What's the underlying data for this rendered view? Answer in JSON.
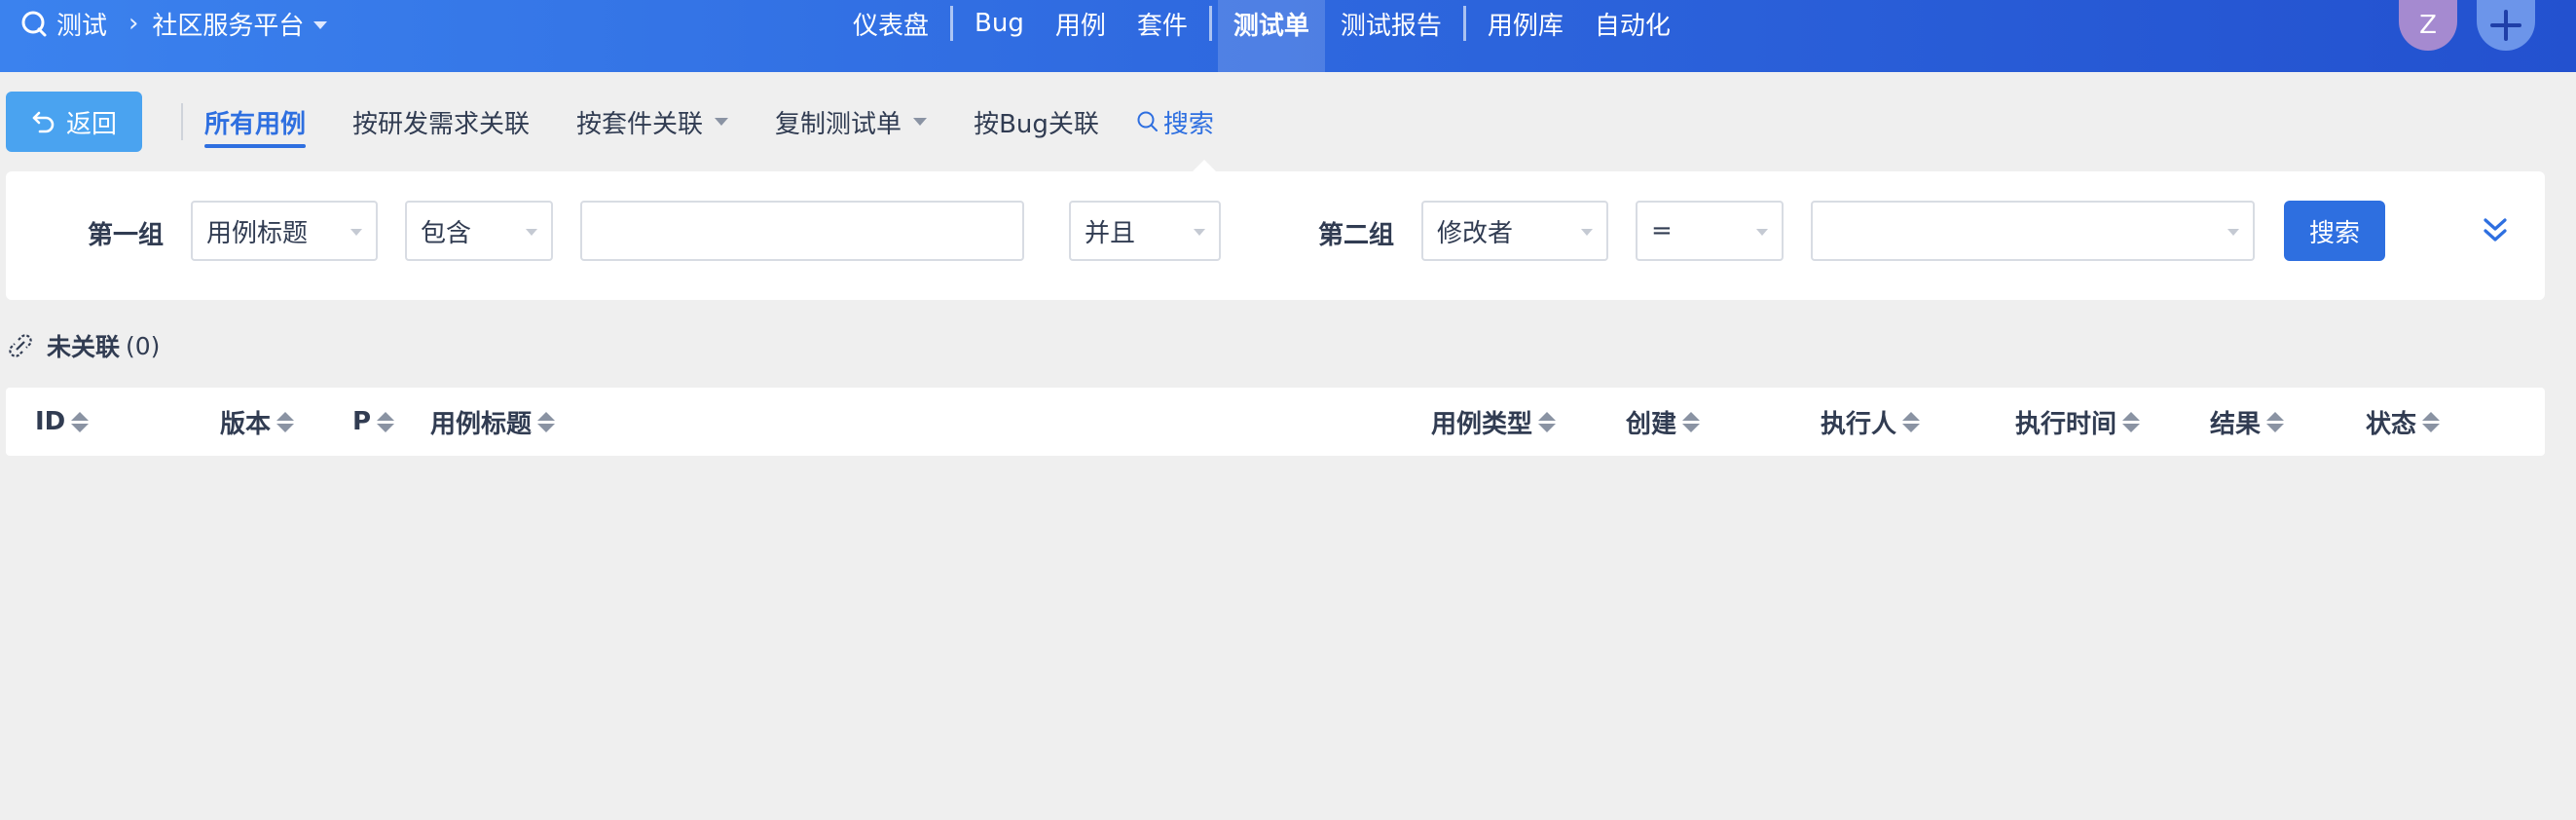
{
  "header": {
    "breadcrumb": {
      "module": "测试",
      "project": "社区服务平台"
    },
    "nav": {
      "dashboard": "仪表盘",
      "bug": "Bug",
      "testcase": "用例",
      "suite": "套件",
      "testtask": "测试单",
      "testreport": "测试报告",
      "caselib": "用例库",
      "automation": "自动化"
    },
    "active_nav": "测试单",
    "avatar_initial": "Z"
  },
  "toolbar": {
    "back_label": "返回",
    "tabs": {
      "all_cases": "所有用例",
      "by_story": "按研发需求关联",
      "by_suite": "按套件关联",
      "copy_task": "复制测试单",
      "by_bug": "按Bug关联",
      "search": "搜索"
    },
    "active_tab": "所有用例"
  },
  "search_form": {
    "group1": {
      "label": "第一组",
      "field": "用例标题",
      "operator": "包含",
      "value": ""
    },
    "logic": "并且",
    "group2": {
      "label": "第二组",
      "field": "修改者",
      "operator": "=",
      "value": ""
    },
    "submit_label": "搜索"
  },
  "section": {
    "title": "未关联",
    "count": "(0)"
  },
  "table": {
    "columns": {
      "id": "ID",
      "version": "版本",
      "priority": "P",
      "title": "用例标题",
      "type": "用例类型",
      "created": "创建",
      "executor": "执行人",
      "exec_time": "执行时间",
      "result": "结果",
      "status": "状态"
    },
    "rows": []
  },
  "colors": {
    "header_gradient_start": "#3b82ee",
    "header_gradient_end": "#2351cf",
    "primary": "#2e6fe0",
    "back_button": "#4aa3f0",
    "avatar_bg": "#a58ad0",
    "page_bg": "#efefef"
  }
}
